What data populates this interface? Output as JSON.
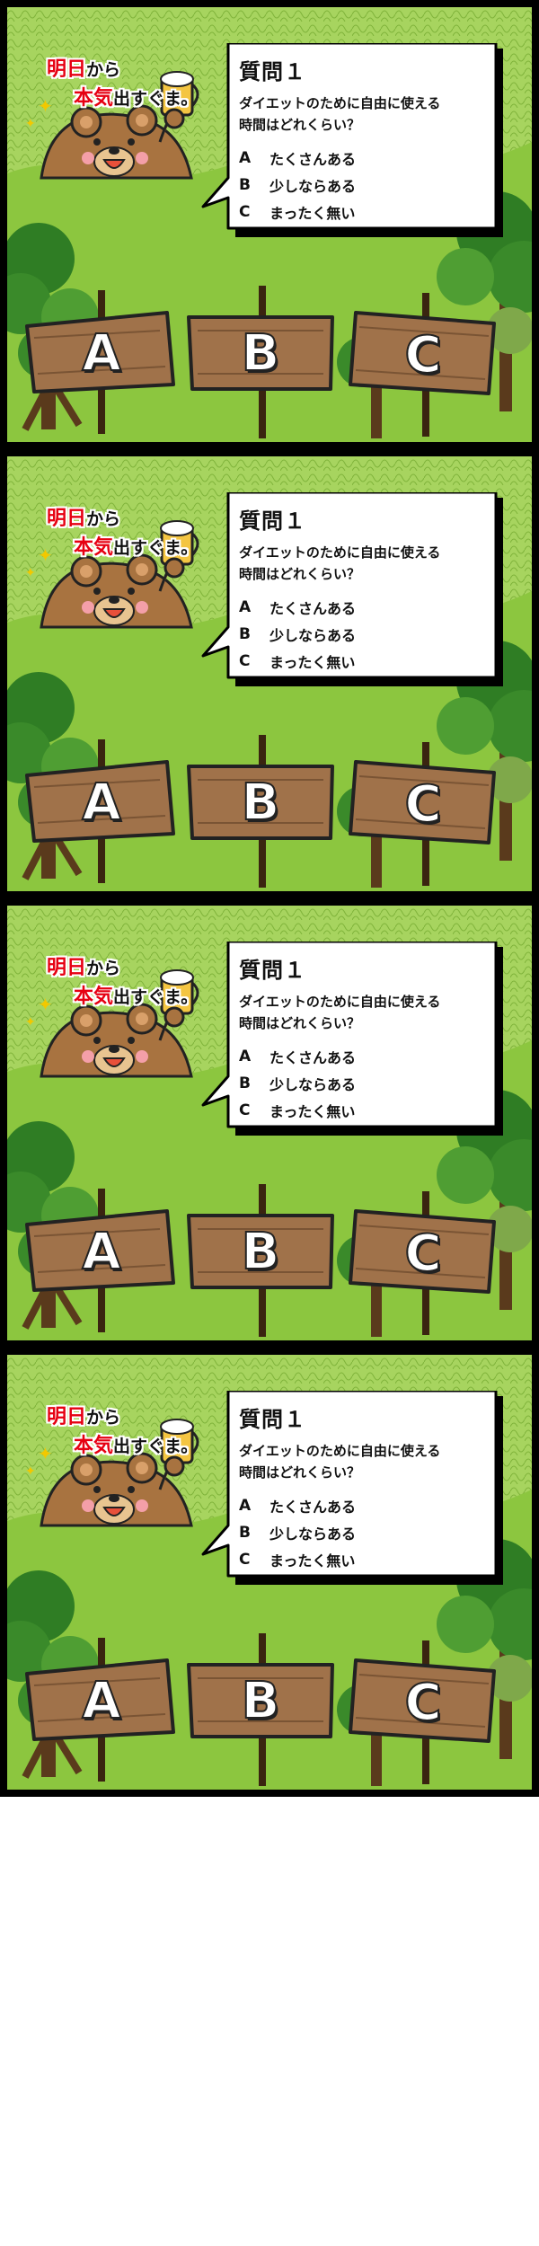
{
  "panels": [
    {
      "caption": {
        "line1_red": "明日",
        "line1_black": "から",
        "line2_red": "本気",
        "line2_black": "出すぐま。"
      },
      "question": {
        "title": "質問１",
        "text_line1": "ダイエットのために自由に使える",
        "text_line2": "時間はどれくらい？",
        "options": [
          {
            "letter": "A",
            "label": "たくさんある"
          },
          {
            "letter": "B",
            "label": "少しならある"
          },
          {
            "letter": "C",
            "label": "まったく無い"
          }
        ]
      },
      "signs": [
        "A",
        "B",
        "C"
      ]
    },
    {
      "caption": {
        "line1_red": "明日",
        "line1_black": "から",
        "line2_red": "本気",
        "line2_black": "出すぐま。"
      },
      "question": {
        "title": "質問１",
        "text_line1": "ダイエットのために自由に使える",
        "text_line2": "時間はどれくらい？",
        "options": [
          {
            "letter": "A",
            "label": "たくさんある"
          },
          {
            "letter": "B",
            "label": "少しならある"
          },
          {
            "letter": "C",
            "label": "まったく無い"
          }
        ]
      },
      "signs": [
        "A",
        "B",
        "C"
      ]
    },
    {
      "caption": {
        "line1_red": "明日",
        "line1_black": "から",
        "line2_red": "本気",
        "line2_black": "出すぐま。"
      },
      "question": {
        "title": "質問１",
        "text_line1": "ダイエットのために自由に使える",
        "text_line2": "時間はどれくらい？",
        "options": [
          {
            "letter": "A",
            "label": "たくさんある"
          },
          {
            "letter": "B",
            "label": "少しならある"
          },
          {
            "letter": "C",
            "label": "まったく無い"
          }
        ]
      },
      "signs": [
        "A",
        "B",
        "C"
      ]
    },
    {
      "caption": {
        "line1_red": "明日",
        "line1_black": "から",
        "line2_red": "本気",
        "line2_black": "出すぐま。"
      },
      "question": {
        "title": "質問１",
        "text_line1": "ダイエットのために自由に使える",
        "text_line2": "時間はどれくらい？",
        "options": [
          {
            "letter": "A",
            "label": "たくさんある"
          },
          {
            "letter": "B",
            "label": "少しならある"
          },
          {
            "letter": "C",
            "label": "まったく無い"
          }
        ]
      },
      "signs": [
        "A",
        "B",
        "C"
      ]
    }
  ],
  "colors": {
    "grass": "#8cc63f",
    "canopy": "#9fce58",
    "tree": "#3a8a2a",
    "wood": "#a0724a",
    "wood_dark": "#4a2e16",
    "bear": "#a87340",
    "caption_red": "#e60012",
    "frame": "#000000"
  }
}
